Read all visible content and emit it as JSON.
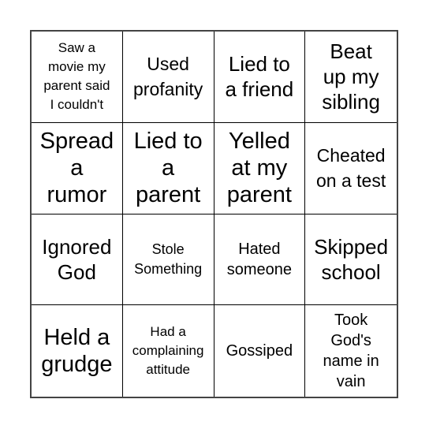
{
  "board": {
    "cells": [
      {
        "text": "Saw a movie my parent said I couldn't",
        "size": "s-xxs",
        "lines": [
          "Saw a",
          "movie my",
          "parent said",
          "I couldn't"
        ]
      },
      {
        "text": "Used profanity",
        "size": "s-m",
        "lines": [
          "Used",
          "profanity"
        ]
      },
      {
        "text": "Lied to a friend",
        "size": "s-l",
        "lines": [
          "Lied to",
          "a friend"
        ]
      },
      {
        "text": "Beat up my sibling",
        "size": "s-l",
        "lines": [
          "Beat",
          "up my",
          "sibling"
        ]
      },
      {
        "text": "Spread a rumor",
        "size": "s-xl",
        "lines": [
          "Spread",
          "a",
          "rumor"
        ]
      },
      {
        "text": "Lied to a parent",
        "size": "s-xl",
        "lines": [
          "Lied to",
          "a",
          "parent"
        ]
      },
      {
        "text": "Yelled at my parent",
        "size": "s-xl",
        "lines": [
          "Yelled",
          "at my",
          "parent"
        ]
      },
      {
        "text": "Cheated on a test",
        "size": "s-m",
        "lines": [
          "Cheated",
          "on a test"
        ]
      },
      {
        "text": "Ignored God",
        "size": "s-l",
        "lines": [
          "Ignored",
          "God"
        ]
      },
      {
        "text": "Stole Something",
        "size": "s-xs",
        "lines": [
          "Stole",
          "Something"
        ]
      },
      {
        "text": "Hated someone",
        "size": "s-s",
        "lines": [
          "Hated",
          "someone"
        ]
      },
      {
        "text": "Skipped school",
        "size": "s-l",
        "lines": [
          "Skipped",
          "school"
        ]
      },
      {
        "text": "Held a grudge",
        "size": "s-xl",
        "lines": [
          "Held a",
          "grudge"
        ]
      },
      {
        "text": "Had a complaining attitude",
        "size": "s-xxs",
        "lines": [
          "Had a",
          "complaining",
          "attitude"
        ]
      },
      {
        "text": "Gossiped",
        "size": "s-s",
        "lines": [
          "Gossiped"
        ]
      },
      {
        "text": "Took God's name in vain",
        "size": "s-s",
        "lines": [
          "Took",
          "God's",
          "name in",
          "vain"
        ]
      }
    ]
  }
}
